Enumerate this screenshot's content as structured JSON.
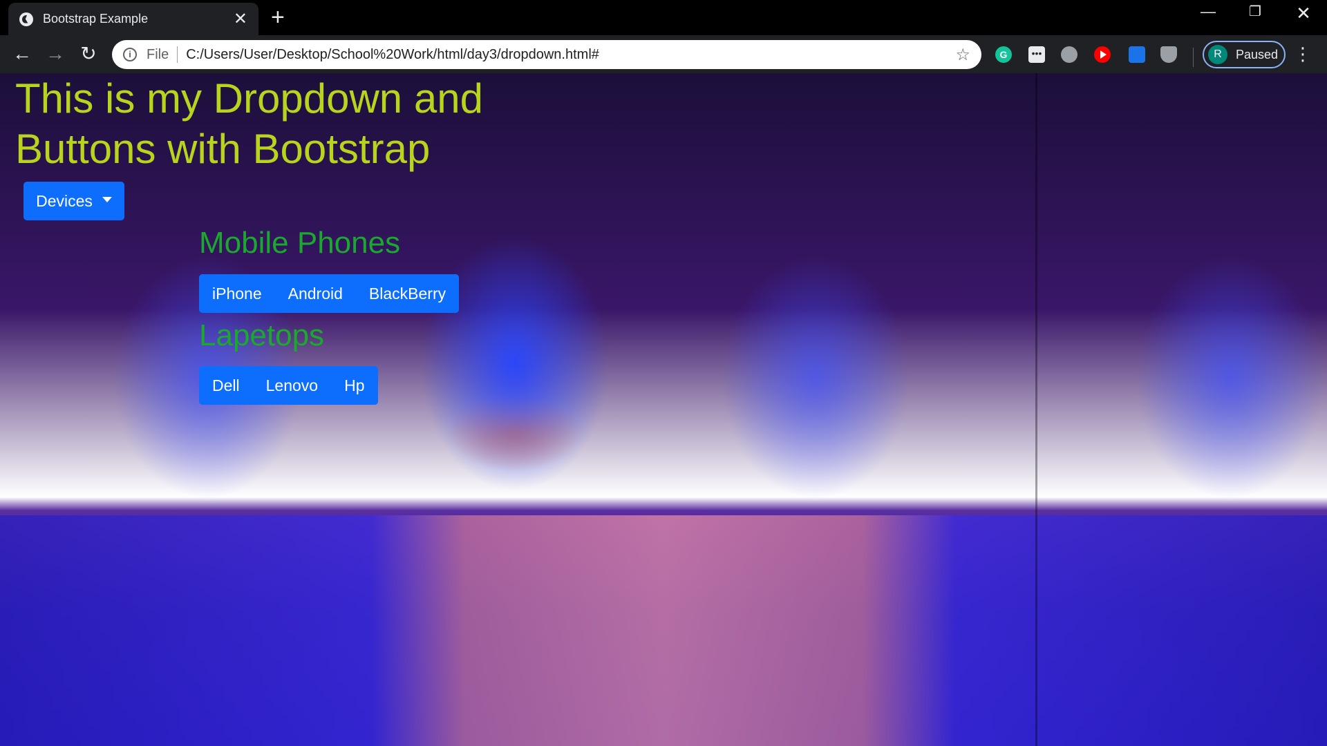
{
  "browser": {
    "tab_title": "Bootstrap Example",
    "tab_close": "✕",
    "new_tab": "+",
    "window_controls": {
      "minimize": "—",
      "maximize": "❐",
      "close": "✕"
    },
    "nav": {
      "back": "←",
      "forward": "→",
      "reload": "↻"
    },
    "address": {
      "info_icon": "i",
      "scheme_label": "File",
      "url": "C:/Users/User/Desktop/School%20Work/html/day3/dropdown.html#",
      "bookmark_icon": "☆"
    },
    "extensions": [
      {
        "name": "grammarly-icon",
        "glyph": "G"
      },
      {
        "name": "dots-extension-icon",
        "glyph": "•••"
      },
      {
        "name": "globe-extension-icon",
        "glyph": ""
      },
      {
        "name": "youtube-extension-icon",
        "glyph": ""
      },
      {
        "name": "cast-extension-icon",
        "glyph": ""
      },
      {
        "name": "shield-extension-icon",
        "glyph": ""
      }
    ],
    "profile": {
      "initial": "R",
      "status": "Paused"
    },
    "menu_icon": "⋮"
  },
  "page": {
    "title": "This is my Dropdown and Buttons with Bootstrap",
    "dropdown": {
      "label": "Devices"
    },
    "sections": {
      "phones": {
        "title": "Mobile Phones",
        "buttons": [
          "iPhone",
          "Android",
          "BlackBerry"
        ]
      },
      "laptops": {
        "title": "Lapetops",
        "buttons": [
          "Dell",
          "Lenovo",
          "Hp"
        ]
      }
    }
  },
  "colors": {
    "title_color": "#b9d41d",
    "section_color": "#1aa82e",
    "button_bg": "#0d6efd"
  }
}
